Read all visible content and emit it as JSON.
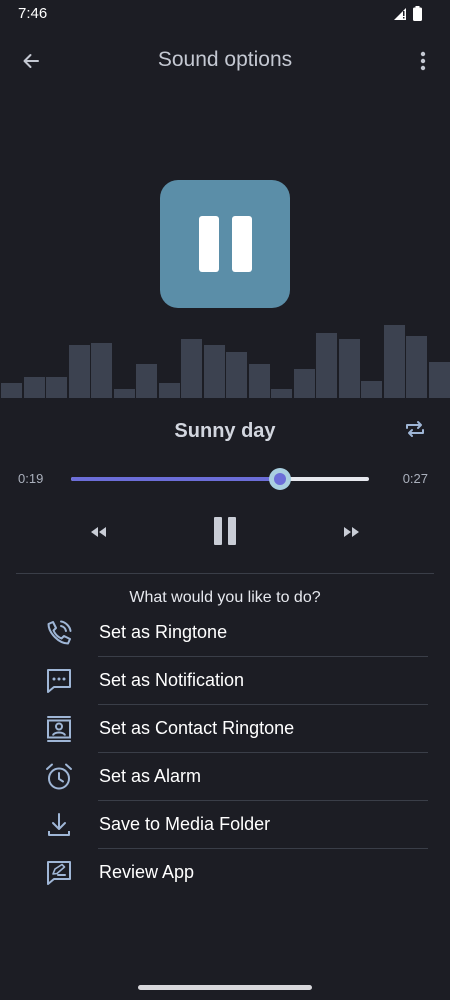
{
  "status_bar": {
    "time": "7:46"
  },
  "app_bar": {
    "title": "Sound options"
  },
  "player": {
    "sound_title": "Sunny day",
    "current_time": "0:19",
    "total_time": "0:27",
    "progress": 0.7,
    "state": "playing",
    "waveform_levels": [
      0.2,
      0.28,
      0.28,
      0.7,
      0.72,
      0.12,
      0.45,
      0.2,
      0.78,
      0.7,
      0.6,
      0.45,
      0.12,
      0.38,
      0.85,
      0.78,
      0.22,
      0.96,
      0.82,
      0.48
    ]
  },
  "actions": {
    "prompt": "What would you like to do?",
    "items": [
      {
        "label": "Set as Ringtone",
        "icon": "phone-ringing-icon"
      },
      {
        "label": "Set as Notification",
        "icon": "chat-bubble-icon"
      },
      {
        "label": "Set as Contact Ringtone",
        "icon": "contact-card-icon"
      },
      {
        "label": "Set as Alarm",
        "icon": "alarm-clock-icon"
      },
      {
        "label": "Save to Media Folder",
        "icon": "download-icon"
      },
      {
        "label": "Review App",
        "icon": "review-icon"
      }
    ]
  },
  "colors": {
    "background": "#1c1d24",
    "accent": "#6c6ed8",
    "play_tile": "#5b8ea8",
    "waveform": "#3c4250"
  }
}
